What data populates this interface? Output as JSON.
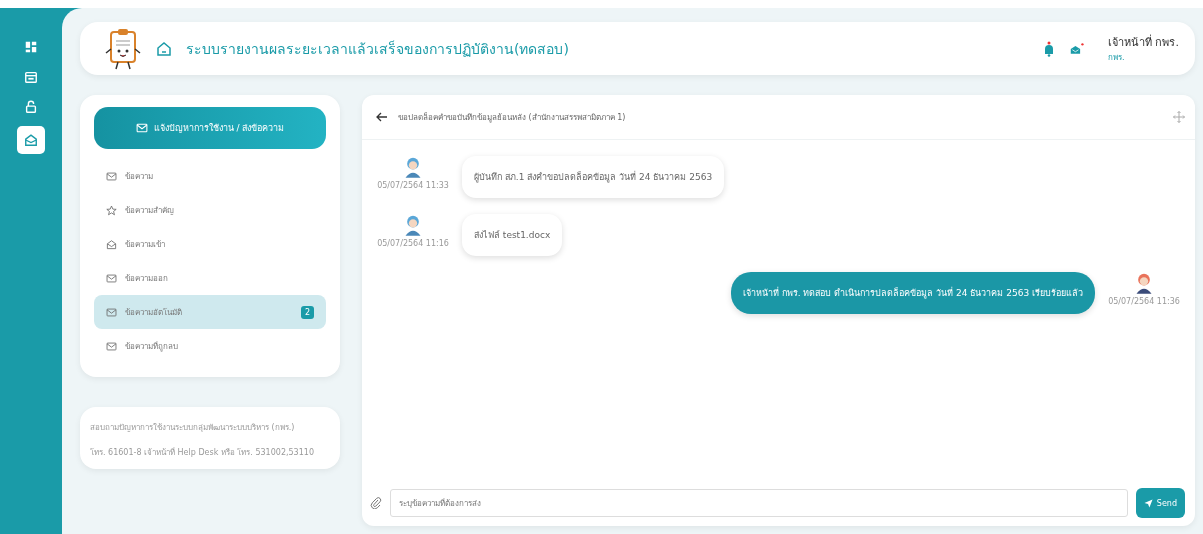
{
  "nav": [
    {
      "selected": false
    },
    {
      "selected": false
    },
    {
      "selected": false
    },
    {
      "selected": true
    }
  ],
  "header": {
    "title": "ระบบรายงานผลระยะเวลาแล้วเสร็จของการปฏิบัติงาน(ทดสอบ)",
    "user_name": "เจ้าหน้าที่ กพร.",
    "user_role": "กพร."
  },
  "compose_button": "แจ้งปัญหาการใช้งาน / ส่งข้อความ",
  "folders": [
    {
      "label": "ข้อความ",
      "kind": "mail",
      "selected": false
    },
    {
      "label": "ข้อความสำคัญ",
      "kind": "star",
      "selected": false
    },
    {
      "label": "ข้อความเข้า",
      "kind": "inbox",
      "selected": false
    },
    {
      "label": "ข้อความออก",
      "kind": "mail",
      "selected": false
    },
    {
      "label": "ข้อความอัตโนมัติ",
      "kind": "mail",
      "selected": true,
      "badge": "2"
    },
    {
      "label": "ข้อความที่ถูกลบ",
      "kind": "mail",
      "selected": false
    }
  ],
  "help": [
    "สอบถามปัญหาการใช้งานระบบกลุ่มพัฒนาระบบบริหาร (กพร.)",
    "โทร. 61601-8 เจ้าหน้าที่ Help Desk หรือ โทร. 531002,53110"
  ],
  "chat": {
    "title": "ขอปลดล็อคคำขอบันทึกข้อมูลย้อนหลัง (สำนักงานสรรพสามิตภาค 1)",
    "messages": [
      {
        "kind": "incoming",
        "text": "ผู้บันทึก สภ.1 ส่งคำขอปลดล็อคข้อมูล วันที่ 24 ธันวาคม 2563",
        "time": "05/07/2564 11:33"
      },
      {
        "kind": "incoming",
        "text": "ส่งไฟล์ test1.docx",
        "time": "05/07/2564 11:16"
      },
      {
        "kind": "outgoing",
        "text": "เจ้าหน้าที่ กพร. ทดสอบ ดำเนินการปลดล็อคข้อมูล วันที่ 24 ธันวาคม 2563 เรียบร้อยแล้ว",
        "time": "05/07/2564 11:36"
      }
    ],
    "placeholder": "ระบุข้อความที่ต้องการส่ง",
    "send": "Send"
  }
}
